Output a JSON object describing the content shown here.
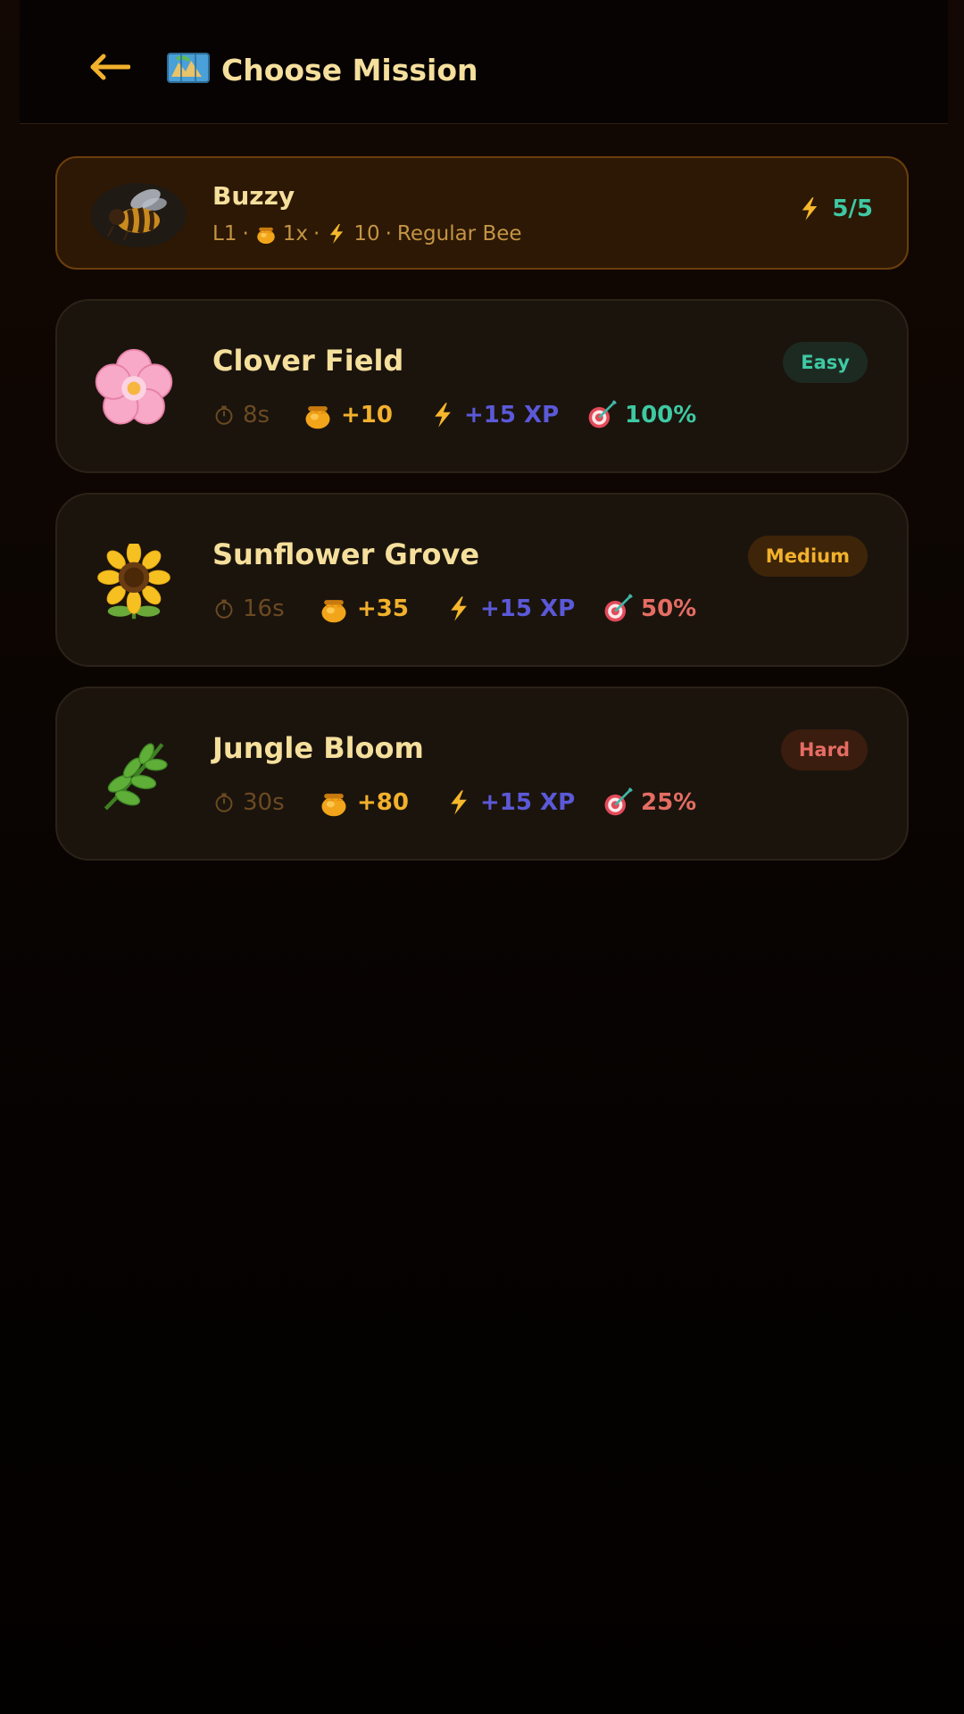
{
  "header": {
    "title": "Choose Mission",
    "back_icon": "arrow-left-icon",
    "title_icon": "map-icon",
    "accent": "#f2b12c"
  },
  "bee": {
    "name": "Buzzy",
    "level": "L1",
    "honey_multiplier": "1x",
    "energy_cost": "10",
    "type": "Regular Bee",
    "energy": "5/5"
  },
  "missions": [
    {
      "name": "Clover Field",
      "icon": "cherry-blossom-icon",
      "time": "8s",
      "honey": "+10",
      "xp": "+15 XP",
      "success": "100%",
      "difficulty": "Easy",
      "difficulty_color": "#3ec9a3",
      "difficulty_bg": "#1d2a22",
      "success_color": "#3ec9a3"
    },
    {
      "name": "Sunflower Grove",
      "icon": "sunflower-icon",
      "time": "16s",
      "honey": "+35",
      "xp": "+15 XP",
      "success": "50%",
      "difficulty": "Medium",
      "difficulty_color": "#f2b12c",
      "difficulty_bg": "#3e2509",
      "success_color": "#e56d63"
    },
    {
      "name": "Jungle Bloom",
      "icon": "herb-icon",
      "time": "30s",
      "honey": "+80",
      "xp": "+15 XP",
      "success": "25%",
      "difficulty": "Hard",
      "difficulty_color": "#e56d63",
      "difficulty_bg": "#3a1d0e",
      "success_color": "#e56d63"
    }
  ]
}
